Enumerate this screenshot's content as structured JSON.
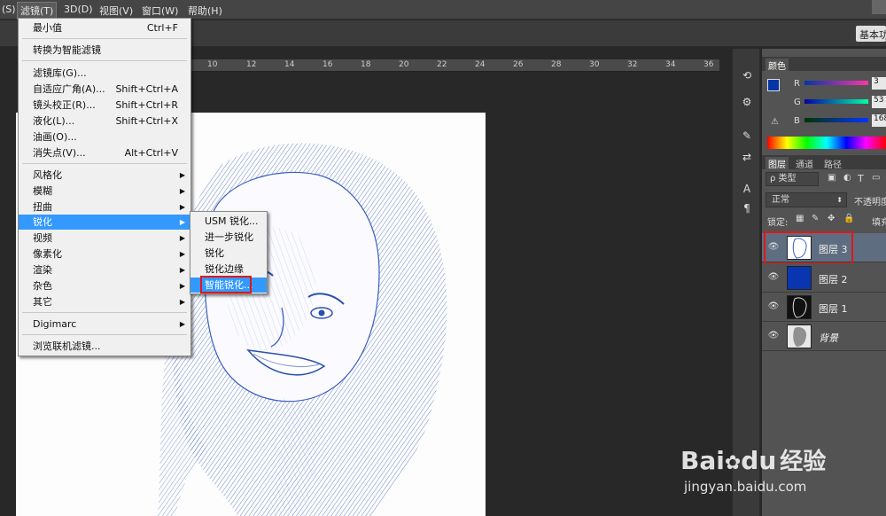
{
  "menubar": {
    "items": [
      {
        "label": "(S)"
      },
      {
        "label": "滤镜(T)"
      },
      {
        "label": "3D(D)"
      },
      {
        "label": "视图(V)"
      },
      {
        "label": "窗口(W)"
      },
      {
        "label": "帮助(H)"
      }
    ]
  },
  "options_bar": {
    "workspace_label": "基本功能"
  },
  "ruler": {
    "ticks": [
      "10",
      "12",
      "14",
      "16",
      "18",
      "20",
      "22",
      "24",
      "26",
      "28",
      "30",
      "32",
      "34",
      "36"
    ]
  },
  "filter_menu": {
    "items": [
      {
        "label": "最小值",
        "shortcut": "Ctrl+F"
      },
      {
        "label": "转换为智能滤镜",
        "shortcut": ""
      },
      {
        "label": "滤镜库(G)...",
        "shortcut": ""
      },
      {
        "label": "自适应广角(A)...",
        "shortcut": "Shift+Ctrl+A"
      },
      {
        "label": "镜头校正(R)...",
        "shortcut": "Shift+Ctrl+R"
      },
      {
        "label": "液化(L)...",
        "shortcut": "Shift+Ctrl+X"
      },
      {
        "label": "油画(O)...",
        "shortcut": ""
      },
      {
        "label": "消失点(V)...",
        "shortcut": "Alt+Ctrl+V"
      },
      {
        "label": "风格化",
        "shortcut": ""
      },
      {
        "label": "模糊",
        "shortcut": ""
      },
      {
        "label": "扭曲",
        "shortcut": ""
      },
      {
        "label": "锐化",
        "shortcut": ""
      },
      {
        "label": "视频",
        "shortcut": ""
      },
      {
        "label": "像素化",
        "shortcut": ""
      },
      {
        "label": "渲染",
        "shortcut": ""
      },
      {
        "label": "杂色",
        "shortcut": ""
      },
      {
        "label": "其它",
        "shortcut": ""
      },
      {
        "label": "Digimarc",
        "shortcut": ""
      },
      {
        "label": "浏览联机滤镜...",
        "shortcut": ""
      }
    ],
    "submenu_arrow": "▶"
  },
  "sharpen_submenu": {
    "items": [
      {
        "label": "USM 锐化..."
      },
      {
        "label": "进一步锐化"
      },
      {
        "label": "锐化"
      },
      {
        "label": "锐化边缘"
      },
      {
        "label": "智能锐化..."
      }
    ]
  },
  "color_panel": {
    "tab": "颜色",
    "r_label": "R",
    "g_label": "G",
    "b_label": "B",
    "r_value": "3",
    "g_value": "53",
    "b_value": "168",
    "fg_color": "#0335a8"
  },
  "layers_panel": {
    "tabs": [
      "图层",
      "通道",
      "路径"
    ],
    "filter_label": "ρ 类型",
    "blend_mode": "正常",
    "opacity_label": "不透明度",
    "lock_label": "锁定:",
    "fill_label": "填充",
    "layers": [
      {
        "name": "图层 3",
        "selected": true
      },
      {
        "name": "图层 2",
        "selected": false
      },
      {
        "name": "图层 1",
        "selected": false
      },
      {
        "name": "背景",
        "selected": false
      }
    ]
  },
  "watermark": {
    "brand_a": "Bai",
    "brand_b": "du",
    "brand_c": "经验",
    "url": "jingyan.baidu.com"
  }
}
